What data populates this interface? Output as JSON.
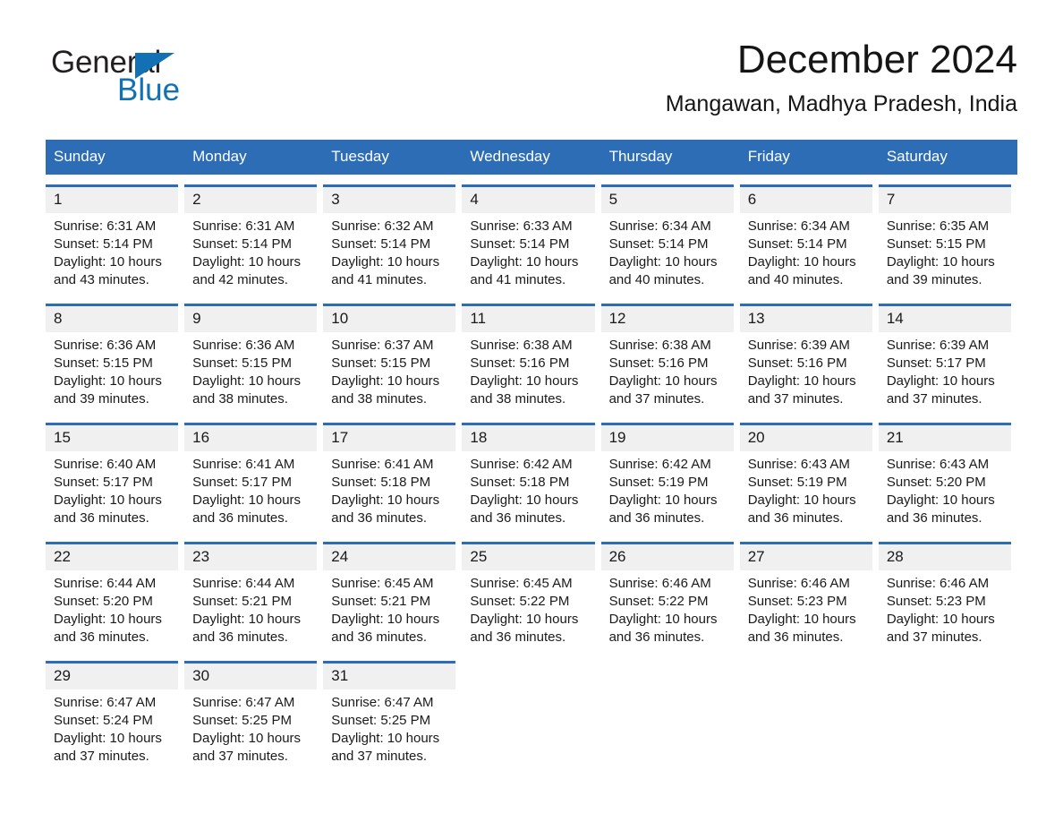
{
  "brand": {
    "name_part1": "General",
    "name_part2": "Blue",
    "triangle_color": "#1271b5"
  },
  "header": {
    "month_title": "December 2024",
    "location": "Mangawan, Madhya Pradesh, India"
  },
  "colors": {
    "header_blue": "#2c6db5",
    "daynum_band": "#f0f0f0",
    "text": "#1a1a1a",
    "page_background": "#ffffff"
  },
  "weekday_headers": [
    "Sunday",
    "Monday",
    "Tuesday",
    "Wednesday",
    "Thursday",
    "Friday",
    "Saturday"
  ],
  "weeks": [
    [
      {
        "day": "1",
        "sunrise": "Sunrise: 6:31 AM",
        "sunset": "Sunset: 5:14 PM",
        "daylight": "Daylight: 10 hours and 43 minutes."
      },
      {
        "day": "2",
        "sunrise": "Sunrise: 6:31 AM",
        "sunset": "Sunset: 5:14 PM",
        "daylight": "Daylight: 10 hours and 42 minutes."
      },
      {
        "day": "3",
        "sunrise": "Sunrise: 6:32 AM",
        "sunset": "Sunset: 5:14 PM",
        "daylight": "Daylight: 10 hours and 41 minutes."
      },
      {
        "day": "4",
        "sunrise": "Sunrise: 6:33 AM",
        "sunset": "Sunset: 5:14 PM",
        "daylight": "Daylight: 10 hours and 41 minutes."
      },
      {
        "day": "5",
        "sunrise": "Sunrise: 6:34 AM",
        "sunset": "Sunset: 5:14 PM",
        "daylight": "Daylight: 10 hours and 40 minutes."
      },
      {
        "day": "6",
        "sunrise": "Sunrise: 6:34 AM",
        "sunset": "Sunset: 5:14 PM",
        "daylight": "Daylight: 10 hours and 40 minutes."
      },
      {
        "day": "7",
        "sunrise": "Sunrise: 6:35 AM",
        "sunset": "Sunset: 5:15 PM",
        "daylight": "Daylight: 10 hours and 39 minutes."
      }
    ],
    [
      {
        "day": "8",
        "sunrise": "Sunrise: 6:36 AM",
        "sunset": "Sunset: 5:15 PM",
        "daylight": "Daylight: 10 hours and 39 minutes."
      },
      {
        "day": "9",
        "sunrise": "Sunrise: 6:36 AM",
        "sunset": "Sunset: 5:15 PM",
        "daylight": "Daylight: 10 hours and 38 minutes."
      },
      {
        "day": "10",
        "sunrise": "Sunrise: 6:37 AM",
        "sunset": "Sunset: 5:15 PM",
        "daylight": "Daylight: 10 hours and 38 minutes."
      },
      {
        "day": "11",
        "sunrise": "Sunrise: 6:38 AM",
        "sunset": "Sunset: 5:16 PM",
        "daylight": "Daylight: 10 hours and 38 minutes."
      },
      {
        "day": "12",
        "sunrise": "Sunrise: 6:38 AM",
        "sunset": "Sunset: 5:16 PM",
        "daylight": "Daylight: 10 hours and 37 minutes."
      },
      {
        "day": "13",
        "sunrise": "Sunrise: 6:39 AM",
        "sunset": "Sunset: 5:16 PM",
        "daylight": "Daylight: 10 hours and 37 minutes."
      },
      {
        "day": "14",
        "sunrise": "Sunrise: 6:39 AM",
        "sunset": "Sunset: 5:17 PM",
        "daylight": "Daylight: 10 hours and 37 minutes."
      }
    ],
    [
      {
        "day": "15",
        "sunrise": "Sunrise: 6:40 AM",
        "sunset": "Sunset: 5:17 PM",
        "daylight": "Daylight: 10 hours and 36 minutes."
      },
      {
        "day": "16",
        "sunrise": "Sunrise: 6:41 AM",
        "sunset": "Sunset: 5:17 PM",
        "daylight": "Daylight: 10 hours and 36 minutes."
      },
      {
        "day": "17",
        "sunrise": "Sunrise: 6:41 AM",
        "sunset": "Sunset: 5:18 PM",
        "daylight": "Daylight: 10 hours and 36 minutes."
      },
      {
        "day": "18",
        "sunrise": "Sunrise: 6:42 AM",
        "sunset": "Sunset: 5:18 PM",
        "daylight": "Daylight: 10 hours and 36 minutes."
      },
      {
        "day": "19",
        "sunrise": "Sunrise: 6:42 AM",
        "sunset": "Sunset: 5:19 PM",
        "daylight": "Daylight: 10 hours and 36 minutes."
      },
      {
        "day": "20",
        "sunrise": "Sunrise: 6:43 AM",
        "sunset": "Sunset: 5:19 PM",
        "daylight": "Daylight: 10 hours and 36 minutes."
      },
      {
        "day": "21",
        "sunrise": "Sunrise: 6:43 AM",
        "sunset": "Sunset: 5:20 PM",
        "daylight": "Daylight: 10 hours and 36 minutes."
      }
    ],
    [
      {
        "day": "22",
        "sunrise": "Sunrise: 6:44 AM",
        "sunset": "Sunset: 5:20 PM",
        "daylight": "Daylight: 10 hours and 36 minutes."
      },
      {
        "day": "23",
        "sunrise": "Sunrise: 6:44 AM",
        "sunset": "Sunset: 5:21 PM",
        "daylight": "Daylight: 10 hours and 36 minutes."
      },
      {
        "day": "24",
        "sunrise": "Sunrise: 6:45 AM",
        "sunset": "Sunset: 5:21 PM",
        "daylight": "Daylight: 10 hours and 36 minutes."
      },
      {
        "day": "25",
        "sunrise": "Sunrise: 6:45 AM",
        "sunset": "Sunset: 5:22 PM",
        "daylight": "Daylight: 10 hours and 36 minutes."
      },
      {
        "day": "26",
        "sunrise": "Sunrise: 6:46 AM",
        "sunset": "Sunset: 5:22 PM",
        "daylight": "Daylight: 10 hours and 36 minutes."
      },
      {
        "day": "27",
        "sunrise": "Sunrise: 6:46 AM",
        "sunset": "Sunset: 5:23 PM",
        "daylight": "Daylight: 10 hours and 36 minutes."
      },
      {
        "day": "28",
        "sunrise": "Sunrise: 6:46 AM",
        "sunset": "Sunset: 5:23 PM",
        "daylight": "Daylight: 10 hours and 37 minutes."
      }
    ],
    [
      {
        "day": "29",
        "sunrise": "Sunrise: 6:47 AM",
        "sunset": "Sunset: 5:24 PM",
        "daylight": "Daylight: 10 hours and 37 minutes."
      },
      {
        "day": "30",
        "sunrise": "Sunrise: 6:47 AM",
        "sunset": "Sunset: 5:25 PM",
        "daylight": "Daylight: 10 hours and 37 minutes."
      },
      {
        "day": "31",
        "sunrise": "Sunrise: 6:47 AM",
        "sunset": "Sunset: 5:25 PM",
        "daylight": "Daylight: 10 hours and 37 minutes."
      },
      {
        "day": "",
        "sunrise": "",
        "sunset": "",
        "daylight": ""
      },
      {
        "day": "",
        "sunrise": "",
        "sunset": "",
        "daylight": ""
      },
      {
        "day": "",
        "sunrise": "",
        "sunset": "",
        "daylight": ""
      },
      {
        "day": "",
        "sunrise": "",
        "sunset": "",
        "daylight": ""
      }
    ]
  ]
}
